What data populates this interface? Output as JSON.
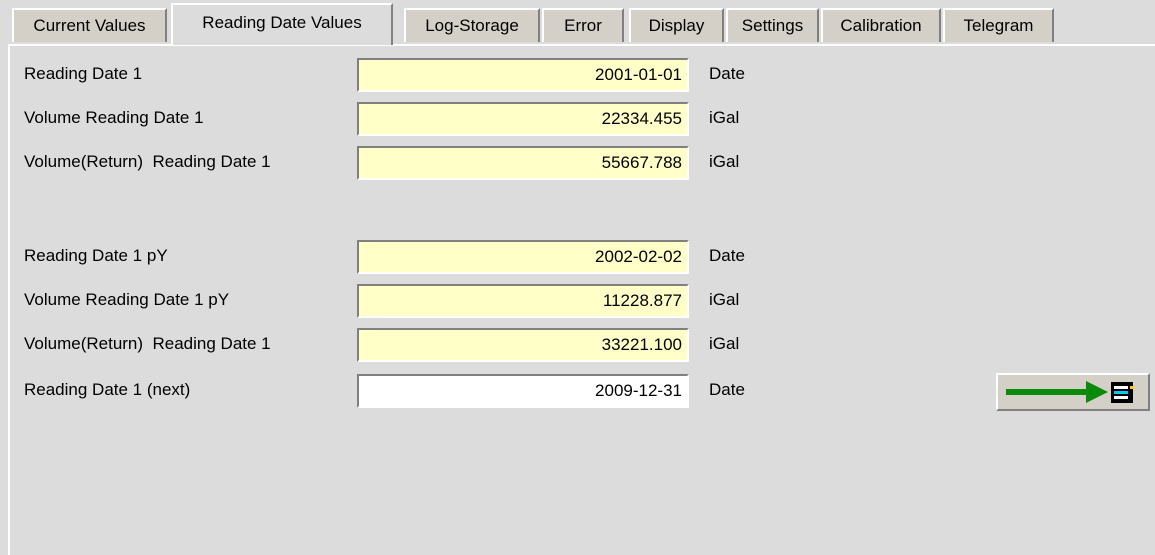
{
  "tabs": [
    {
      "label": "Current Values",
      "active": false
    },
    {
      "label": "Reading Date Values",
      "active": true
    },
    {
      "label": "Log-Storage",
      "active": false
    },
    {
      "label": "Error",
      "active": false
    },
    {
      "label": "Display",
      "active": false
    },
    {
      "label": "Settings",
      "active": false
    },
    {
      "label": "Calibration",
      "active": false
    },
    {
      "label": "Telegram",
      "active": false
    }
  ],
  "rows": [
    {
      "label": "Reading Date 1",
      "value": "2001-01-01",
      "unit": "Date",
      "editable": false
    },
    {
      "label": "Volume Reading Date 1",
      "value": "22334.455",
      "unit": "iGal",
      "editable": false
    },
    {
      "label": "Volume(Return)  Reading Date 1",
      "value": "55667.788",
      "unit": "iGal",
      "editable": false
    },
    {
      "label": "Reading Date 1 pY",
      "value": "2002-02-02",
      "unit": "Date",
      "editable": false
    },
    {
      "label": "Volume Reading Date 1 pY",
      "value": "11228.877",
      "unit": "iGal",
      "editable": false
    },
    {
      "label": "Volume(Return)  Reading Date 1",
      "value": "33221.100",
      "unit": "iGal",
      "editable": false
    },
    {
      "label": "Reading Date 1 (next)",
      "value": "2009-12-31",
      "unit": "Date",
      "editable": true
    }
  ],
  "colors": {
    "readonly_field_bg": "#ffffc8",
    "editable_field_bg": "#ffffff",
    "arrow_green": "#0a8a0a",
    "window_bg": "#dcdcdc"
  },
  "icons": {
    "transfer_button": "green-arrow-to-device-icon"
  }
}
